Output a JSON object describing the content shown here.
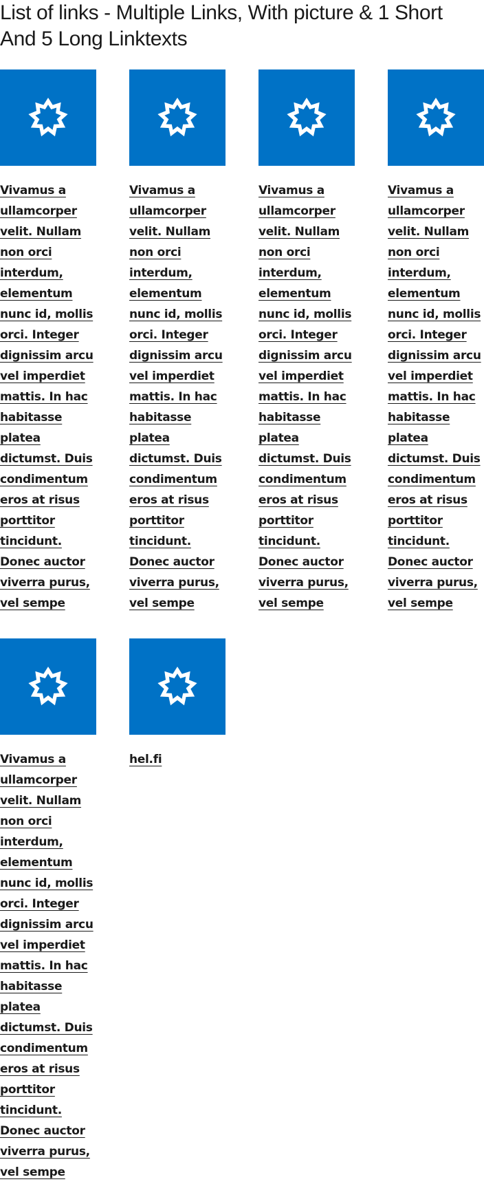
{
  "page": {
    "title": "List of links - Multiple Links, With picture & 1 Short And 5 Long Linktexts"
  },
  "links": [
    {
      "text": "Vivamus a ullamcorper velit. Nullam non orci interdum, elementum nunc id, mollis orci. Integer dignissim arcu vel imperdiet mattis. In hac habitasse platea dictumst. Duis condimentum eros at risus porttitor tincidunt. Donec auctor viverra purus, vel sempe",
      "icon": "helsinki-star-icon"
    },
    {
      "text": "Vivamus a ullamcorper velit. Nullam non orci interdum, elementum nunc id, mollis orci. Integer dignissim arcu vel imperdiet mattis. In hac habitasse platea dictumst. Duis condimentum eros at risus porttitor tincidunt. Donec auctor viverra purus, vel sempe",
      "icon": "helsinki-star-icon"
    },
    {
      "text": "Vivamus a ullamcorper velit. Nullam non orci interdum, elementum nunc id, mollis orci. Integer dignissim arcu vel imperdiet mattis. In hac habitasse platea dictumst. Duis condimentum eros at risus porttitor tincidunt. Donec auctor viverra purus, vel sempe",
      "icon": "helsinki-star-icon"
    },
    {
      "text": "Vivamus a ullamcorper velit. Nullam non orci interdum, elementum nunc id, mollis orci. Integer dignissim arcu vel imperdiet mattis. In hac habitasse platea dictumst. Duis condimentum eros at risus porttitor tincidunt. Donec auctor viverra purus, vel sempe",
      "icon": "helsinki-star-icon"
    },
    {
      "text": "Vivamus a ullamcorper velit. Nullam non orci interdum, elementum nunc id, mollis orci. Integer dignissim arcu vel imperdiet mattis. In hac habitasse platea dictumst. Duis condimentum eros at risus porttitor tincidunt. Donec auctor viverra purus, vel sempe",
      "icon": "helsinki-star-icon"
    },
    {
      "text": "hel.fi",
      "icon": "helsinki-star-icon"
    }
  ],
  "colors": {
    "image_background": "#0072c6",
    "icon": "#ffffff",
    "text": "#1a1a1a"
  }
}
